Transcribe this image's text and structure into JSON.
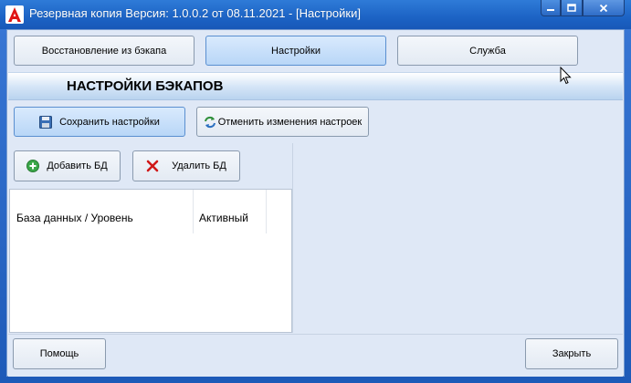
{
  "window": {
    "title": "Резервная копия   Версия: 1.0.0.2 от 08.11.2021 - [Настройки]"
  },
  "tabs": [
    {
      "label": "Восстановление из бэкапа"
    },
    {
      "label": "Настройки"
    },
    {
      "label": "Служба"
    }
  ],
  "section": {
    "title": "НАСТРОЙКИ БЭКАПОВ"
  },
  "toolbar": {
    "save_label": "Сохранить настройки",
    "revert_label": "Отменить изменения настроек"
  },
  "db_toolbar": {
    "add_label": "Добавить БД",
    "delete_label": "Удалить БД"
  },
  "grid": {
    "columns": [
      "База данных / Уровень",
      "Активный"
    ]
  },
  "footer": {
    "help_label": "Помощь",
    "close_label": "Закрыть"
  },
  "colors": {
    "titlebar": "#1c63c4",
    "client_bg": "#dfe8f6",
    "active_tab": "#b8d6f7"
  }
}
